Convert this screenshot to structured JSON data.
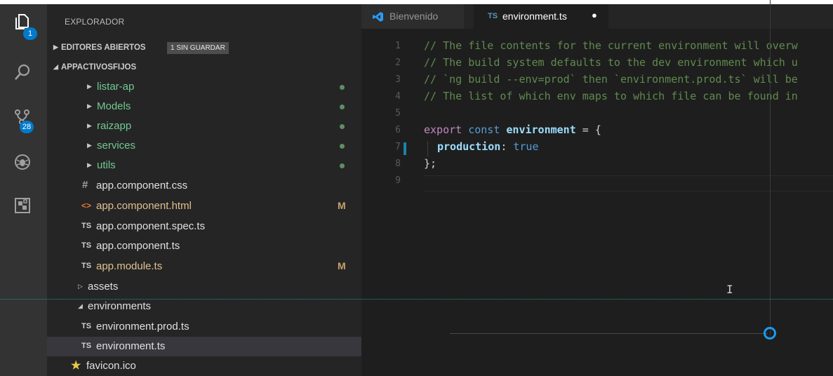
{
  "activity_bar": {
    "explorer_badge": "1",
    "scm_badge": "28"
  },
  "sidebar": {
    "title": "EXPLORADOR",
    "sections": {
      "open_editors": {
        "label": "EDITORES ABIERTOS",
        "unsaved_badge": "1 SIN GUARDAR"
      },
      "project": {
        "label": "APPACTIVOSFIJOS"
      }
    },
    "tree": [
      {
        "name": "listar-ap",
        "type": "folder",
        "collapsed": true,
        "status": "dot"
      },
      {
        "name": "Models",
        "type": "folder",
        "collapsed": true,
        "status": "dot"
      },
      {
        "name": "raizapp",
        "type": "folder",
        "collapsed": true,
        "status": "dot"
      },
      {
        "name": "services",
        "type": "folder",
        "collapsed": true,
        "status": "dot"
      },
      {
        "name": "utils",
        "type": "folder",
        "collapsed": true,
        "status": "dot"
      },
      {
        "name": "app.component.css",
        "type": "css",
        "icon": "#"
      },
      {
        "name": "app.component.html",
        "type": "html",
        "icon": "<>",
        "status": "M"
      },
      {
        "name": "app.component.spec.ts",
        "type": "ts",
        "icon": "TS"
      },
      {
        "name": "app.component.ts",
        "type": "ts",
        "icon": "TS"
      },
      {
        "name": "app.module.ts",
        "type": "ts",
        "icon": "TS",
        "status": "M"
      },
      {
        "name": "assets",
        "type": "folder",
        "collapsed": true
      },
      {
        "name": "environments",
        "type": "folder",
        "collapsed": false
      },
      {
        "name": "environment.prod.ts",
        "type": "ts",
        "icon": "TS"
      },
      {
        "name": "environment.ts",
        "type": "ts",
        "icon": "TS",
        "selected": true
      },
      {
        "name": "favicon.ico",
        "type": "ico",
        "icon": "★"
      }
    ]
  },
  "tabs": [
    {
      "label": "Bienvenido",
      "active": false
    },
    {
      "label": "environment.ts",
      "icon": "TS",
      "active": true,
      "dirty": "●"
    }
  ],
  "editor": {
    "line_numbers": [
      "1",
      "2",
      "3",
      "4",
      "5",
      "6",
      "7",
      "8",
      "9"
    ],
    "lines": {
      "l1": "// The file contents for the current environment will overw",
      "l2": "// The build system defaults to the dev environment which u",
      "l3": "// `ng build --env=prod` then `environment.prod.ts` will be",
      "l4": "// The list of which env maps to which file can be found in",
      "l6_export": "export",
      "l6_const": "const",
      "l6_name": "environment",
      "l6_rest": " = {",
      "l7_key": "production",
      "l7_colon": ": ",
      "l7_val": "true",
      "l8": "};"
    }
  },
  "cursor_glyph": "I",
  "colors": {
    "accent": "#007acc",
    "modified": "#c9a26d",
    "untracked_dot": "#5e8e61",
    "comment": "#608b4e",
    "keyword": "#c586c0"
  }
}
